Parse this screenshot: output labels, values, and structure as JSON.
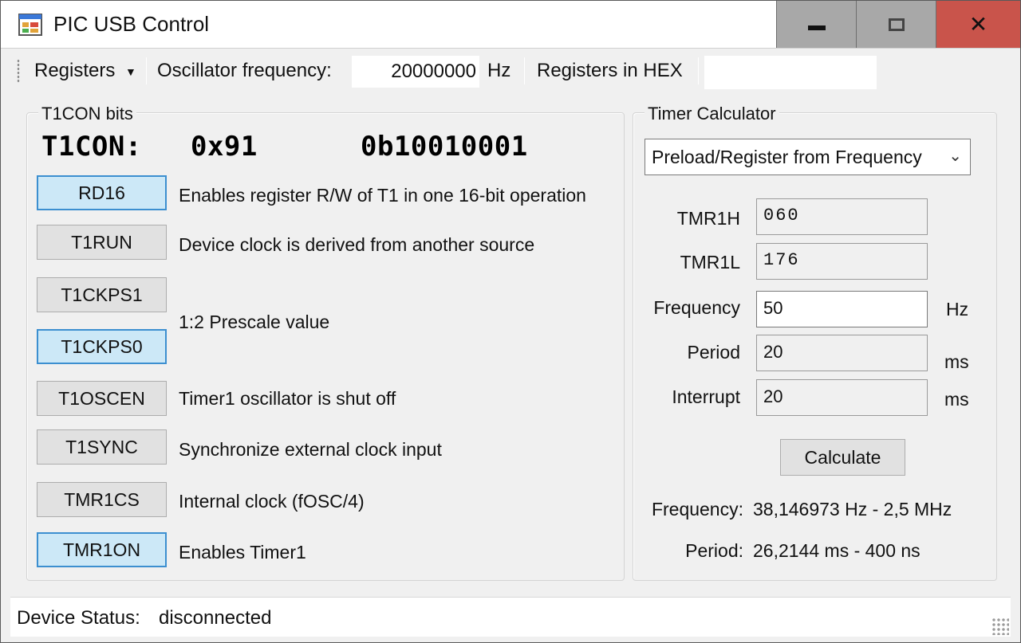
{
  "window": {
    "title": "PIC USB Control",
    "icon": "app-window-icon",
    "controls": {
      "minimize": "minimize-icon",
      "maximize": "maximize-icon",
      "close": "close-icon"
    },
    "close_color": "#c9544b"
  },
  "toolbar": {
    "registers_menu": "Registers",
    "osc_label": "Oscillator frequency:",
    "osc_value": "20000000",
    "osc_unit": "Hz",
    "hex_label": "Registers in HEX",
    "hex_value": ""
  },
  "t1con": {
    "group_title": "T1CON bits",
    "header_name": "T1CON:",
    "header_hex": "0x91",
    "header_bin": "0b10010001",
    "bits": [
      {
        "label": "RD16",
        "active": true,
        "desc": "Enables register R/W of T1 in one 16-bit operation"
      },
      {
        "label": "T1RUN",
        "active": false,
        "desc": "Device clock is derived from another source"
      },
      {
        "label": "T1CKPS1",
        "active": false
      },
      {
        "label": "T1CKPS0",
        "active": true
      },
      {
        "label": "T1OSCEN",
        "active": false,
        "desc": "Timer1 oscillator is shut off"
      },
      {
        "label": "T1SYNC",
        "active": false,
        "desc": "Synchronize external clock input"
      },
      {
        "label": "TMR1CS",
        "active": false,
        "desc": "Internal clock (fOSC/4)"
      },
      {
        "label": "TMR1ON",
        "active": true,
        "desc": "Enables Timer1"
      }
    ],
    "prescale_desc": "1:2 Prescale value",
    "active_color": "#cce8f7",
    "active_border": "#3c8fd0"
  },
  "calculator": {
    "group_title": "Timer Calculator",
    "mode": "Preload/Register from Frequency",
    "fields": {
      "tmr1h_label": "TMR1H",
      "tmr1h_value": "060",
      "tmr1l_label": "TMR1L",
      "tmr1l_value": "176",
      "frequency_label": "Frequency",
      "frequency_value": "50",
      "frequency_unit": "Hz",
      "period_label": "Period",
      "period_value": "20",
      "period_unit": "ms",
      "interrupt_label": "Interrupt",
      "interrupt_value": "20",
      "interrupt_unit": "ms"
    },
    "calculate_label": "Calculate",
    "results": {
      "frequency_label": "Frequency:",
      "frequency_value": "38,146973 Hz - 2,5 MHz",
      "period_label": "Period:",
      "period_value": "26,2144 ms - 400 ns"
    }
  },
  "status": {
    "label": "Device Status:",
    "value": "disconnected"
  }
}
